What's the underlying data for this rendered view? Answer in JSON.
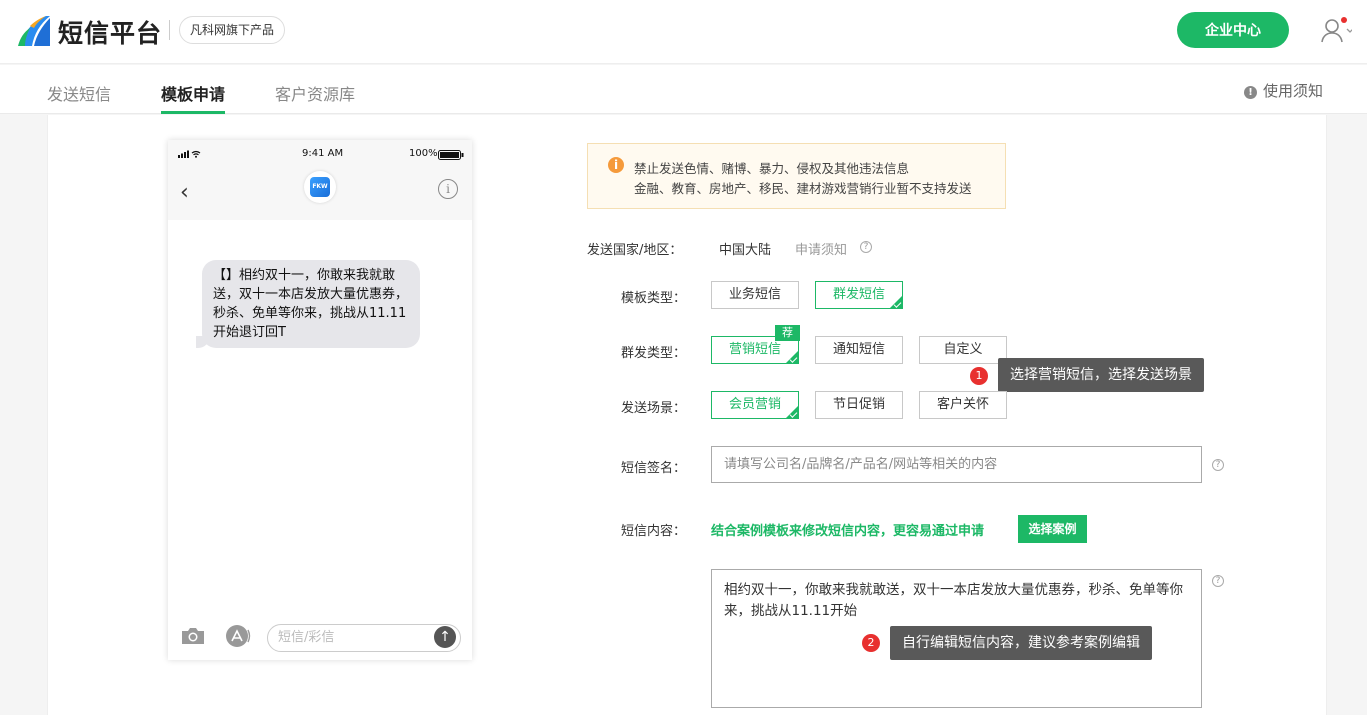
{
  "header": {
    "brand": "短信平台",
    "sub_brand": "凡科网旗下产品",
    "enterprise_button": "企业中心"
  },
  "nav": {
    "tabs": [
      {
        "label": "发送短信",
        "active": false
      },
      {
        "label": "模板申请",
        "active": true
      },
      {
        "label": "客户资源库",
        "active": false
      }
    ],
    "notice_label": "使用须知",
    "accent": "#1db866"
  },
  "phone": {
    "time": "9:41 AM",
    "battery": "100%",
    "avatar_text": "FKW",
    "message": "【】相约双十一，你敢来我就敢送，双十一本店发放大量优惠券，秒杀、免单等你来，挑战从11.11开始退订回T",
    "input_placeholder": "短信/彩信"
  },
  "form": {
    "warning_lines": [
      "禁止发送色情、赌博、暴力、侵权及其他违法信息",
      "金融、教育、房地产、移民、建材游戏营销行业暂不支持发送"
    ],
    "country_label": "发送国家/地区：",
    "country_value": "中国大陆",
    "apply_notice": "申请须知",
    "template_type_label": "模板类型：",
    "template_types": [
      {
        "label": "业务短信",
        "selected": false
      },
      {
        "label": "群发短信",
        "selected": true
      }
    ],
    "group_type_label": "群发类型：",
    "group_types": [
      {
        "label": "营销短信",
        "selected": true
      },
      {
        "label": "通知短信",
        "selected": false
      },
      {
        "label": "自定义",
        "selected": false
      }
    ],
    "recommend_badge": "荐",
    "scene_label": "发送场景：",
    "scenes": [
      {
        "label": "会员营销",
        "selected": true
      },
      {
        "label": "节日促销",
        "selected": false
      },
      {
        "label": "客户关怀",
        "selected": false
      }
    ],
    "tip1_number": "1",
    "tip1_text": "选择营销短信，选择发送场景",
    "signature_label": "短信签名：",
    "signature_placeholder": "请填写公司名/品牌名/产品名/网站等相关的内容",
    "content_label": "短信内容：",
    "content_hint": "结合案例模板来修改短信内容，更容易通过申请",
    "case_button": "选择案例",
    "content_value": "相约双十一，你敢来我就敢送，双十一本店发放大量优惠券，秒杀、免单等你来，挑战从11.11开始",
    "tip2_number": "2",
    "tip2_text": "自行编辑短信内容，建议参考案例编辑"
  }
}
